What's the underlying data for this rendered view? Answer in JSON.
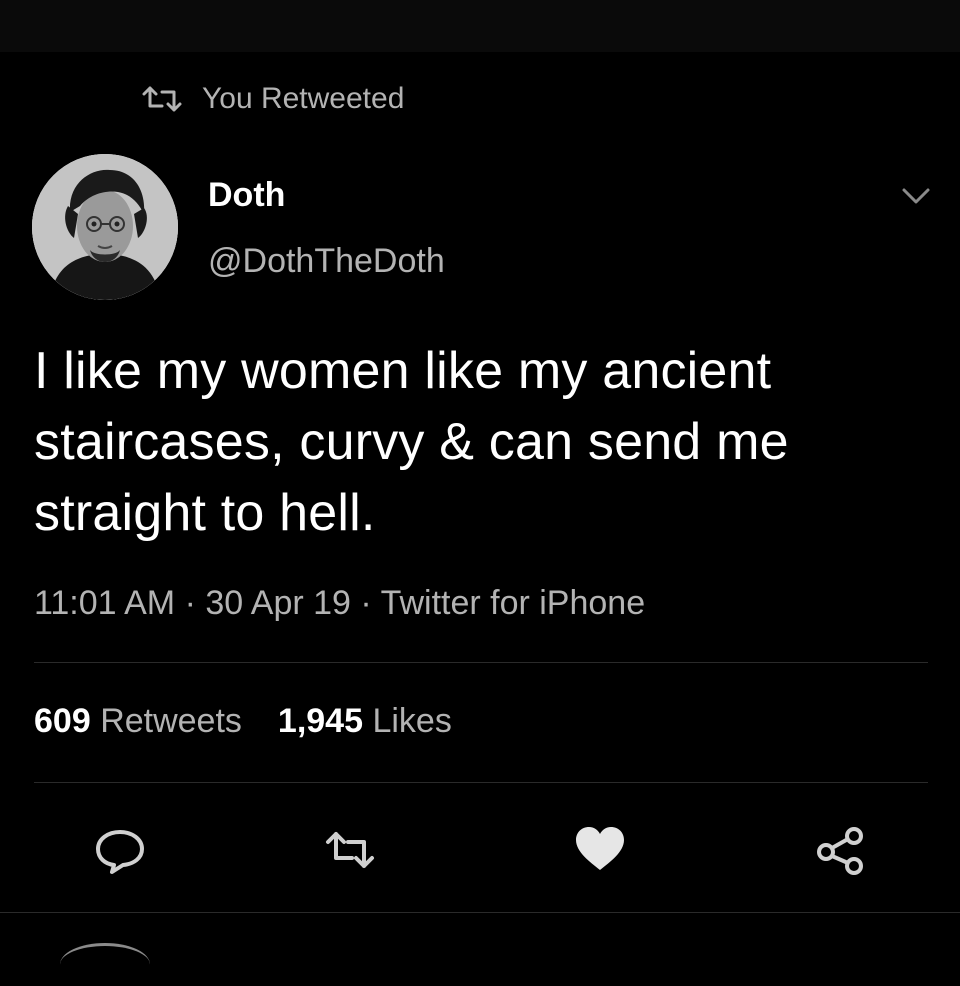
{
  "retweet_banner": {
    "label": "You Retweeted"
  },
  "author": {
    "name": "Doth",
    "handle": "@DothTheDoth"
  },
  "tweet": {
    "text_lines": [
      "I like my women like my ancient",
      "staircases, curvy & can send me",
      "straight to hell."
    ],
    "timestamp": "11:01 AM",
    "date": "30 Apr 19",
    "source": "Twitter for iPhone",
    "separator": "·"
  },
  "stats": {
    "retweets_count": "609",
    "retweets_label": "Retweets",
    "likes_count": "1,945",
    "likes_label": "Likes"
  },
  "actions": {
    "icons": [
      "reply-icon",
      "retweet-icon",
      "like-icon",
      "share-icon"
    ]
  },
  "colors": {
    "background": "#000000",
    "primary_text": "#ffffff",
    "secondary_text": "#b3b3b3",
    "divider": "#2a2a2a"
  }
}
